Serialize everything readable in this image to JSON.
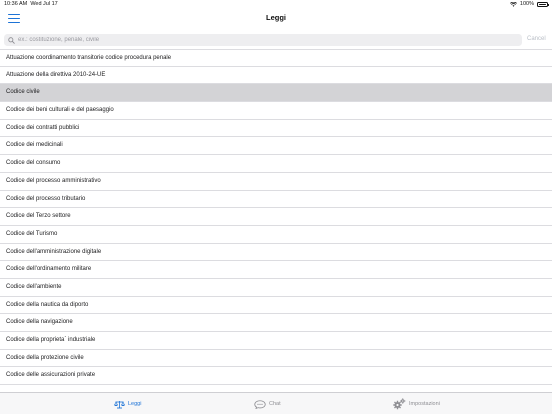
{
  "status_bar": {
    "time": "10:36 AM",
    "date": "Wed Jul 17",
    "battery": "100%"
  },
  "nav": {
    "title": "Leggi",
    "menu_icon": "hamburger-menu-icon"
  },
  "search": {
    "placeholder": "ex.: costituzione, penale, civile",
    "value": "",
    "cancel_label": "Cancel"
  },
  "list": {
    "items": [
      "Attuazione coordinamento transitorie codice procedura penale",
      "Attuazione della direttiva  2010-24-UE",
      "Codice civile",
      "Codice dei beni culturali e del paesaggio",
      "Codice dei contratti pubblici",
      "Codice dei medicinali",
      "Codice del consumo",
      "Codice del processo amministrativo",
      "Codice del processo tributario",
      "Codice del Terzo settore",
      "Codice del Turismo",
      "Codice dell'amministrazione digitale",
      "Codice dell'ordinamento militare",
      "Codice dell'ambiente",
      "Codice della nautica da diporto",
      "Codice della navigazione",
      "Codice della proprieta` industriale",
      "Codice della protezione civile",
      "Codice delle assicurazioni private",
      ""
    ],
    "selected_index": 2
  },
  "tabbar": {
    "tabs": [
      {
        "label": "Leggi",
        "icon": "scales-icon",
        "active": true
      },
      {
        "label": "Chat",
        "icon": "chat-bubble-icon",
        "active": false
      },
      {
        "label": "Impostazioni",
        "icon": "gears-icon",
        "active": false
      }
    ]
  },
  "colors": {
    "accent": "#1d73d6",
    "selected_row": "#d3d3d6",
    "inactive_tab": "#8e8e93"
  }
}
